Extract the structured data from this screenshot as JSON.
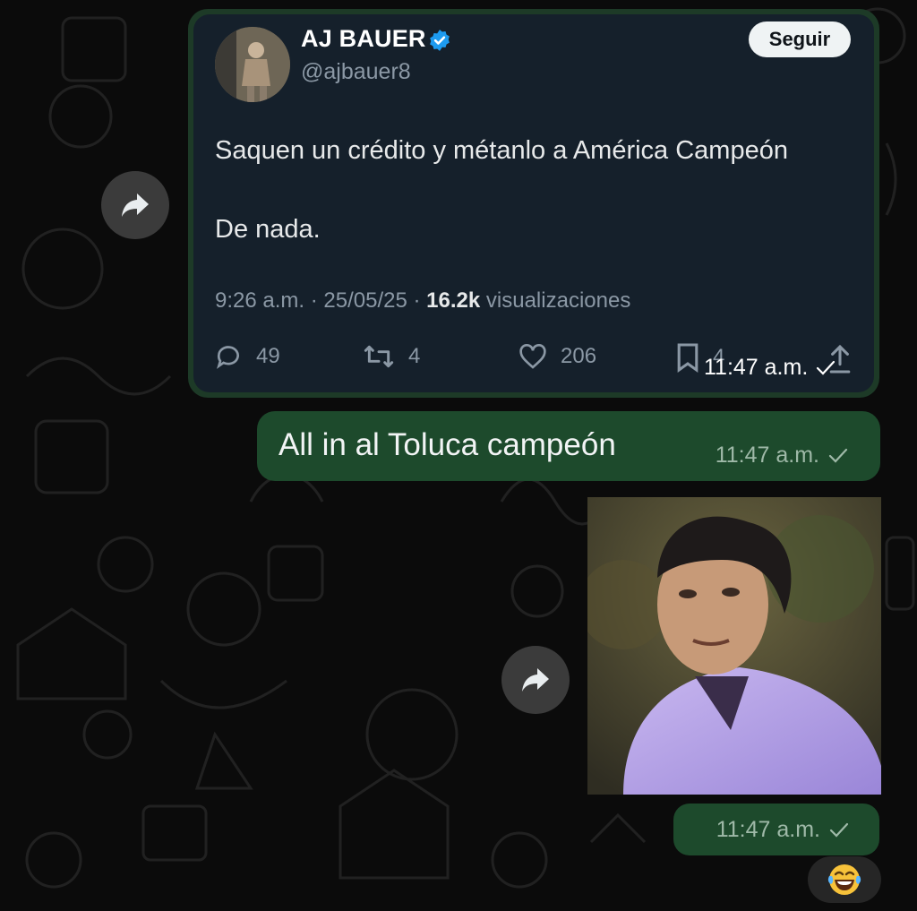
{
  "tweet": {
    "author_name": "AJ BAUER",
    "author_handle": "@ajbauer8",
    "follow_label": "Seguir",
    "text_line1": "Saquen un crédito y métanlo a América Campeón",
    "text_line2": "De nada.",
    "time": "9:26 a.m.",
    "date": "25/05/25",
    "views_count": "16.2k",
    "views_label": "visualizaciones",
    "replies": "49",
    "retweets": "4",
    "likes": "206",
    "bookmarks": "4",
    "message_time": "11:47 a.m."
  },
  "message": {
    "text": "All in al Toluca campeón",
    "time": "11:47 a.m."
  },
  "image_message": {
    "time": "11:47 a.m."
  },
  "reaction": {
    "emoji": "😂",
    "icon": "laughing-tears-emoji"
  },
  "colors": {
    "outgoing_bubble": "#1d4a2c",
    "tweet_background": "#15202b",
    "verified_badge": "#1d9bf0",
    "follow_button": "#eff3f4"
  }
}
